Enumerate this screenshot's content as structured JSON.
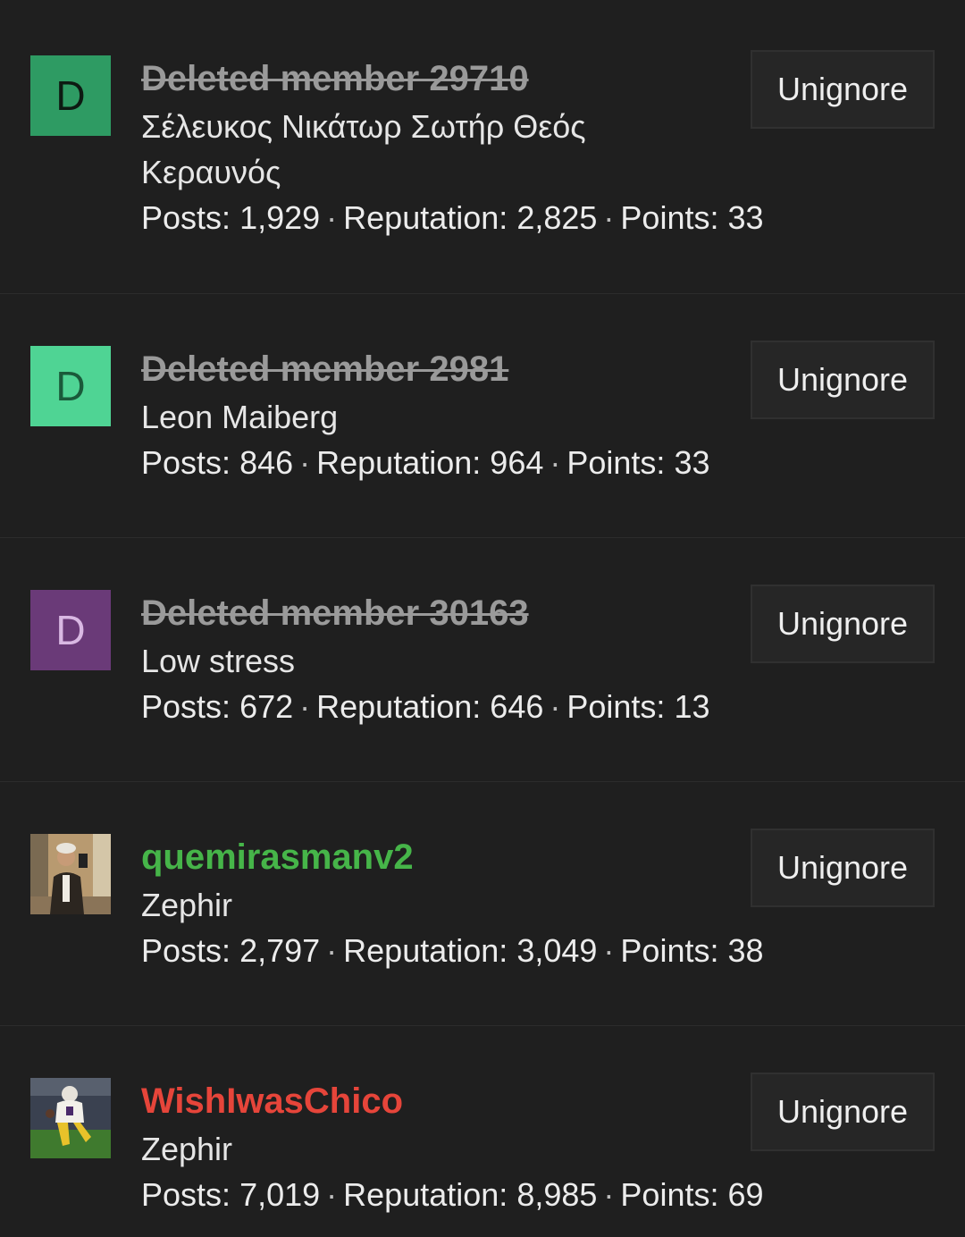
{
  "members": [
    {
      "avatar_letter": "D",
      "avatar_bg": "#2e9b63",
      "avatar_fg": "#0d1a12",
      "username": "Deleted member 29710",
      "deleted": true,
      "title": "Σέλευκος Νικάτωρ Σωτήρ Θεός Κεραυνός",
      "posts_label": "Posts:",
      "posts": "1,929",
      "rep_label": "Reputation:",
      "rep": "2,825",
      "points_label": "Points:",
      "points": "33",
      "button": "Unignore"
    },
    {
      "avatar_letter": "D",
      "avatar_bg": "#4fd494",
      "avatar_fg": "#1a5a3a",
      "username": "Deleted member 2981",
      "deleted": true,
      "title": "Leon Maiberg",
      "posts_label": "Posts:",
      "posts": "846",
      "rep_label": "Reputation:",
      "rep": "964",
      "points_label": "Points:",
      "points": "33",
      "button": "Unignore"
    },
    {
      "avatar_letter": "D",
      "avatar_bg": "#6a3a78",
      "avatar_fg": "#d9b8e3",
      "username": "Deleted member 30163",
      "deleted": true,
      "title": "Low stress",
      "posts_label": "Posts:",
      "posts": "672",
      "rep_label": "Reputation:",
      "rep": "646",
      "points_label": "Points:",
      "points": "13",
      "button": "Unignore"
    },
    {
      "avatar_photo": "person-selfie",
      "username": "quemirasmanv2",
      "username_color": "#46b549",
      "deleted": false,
      "title": "Zephir",
      "posts_label": "Posts:",
      "posts": "2,797",
      "rep_label": "Reputation:",
      "rep": "3,049",
      "points_label": "Points:",
      "points": "38",
      "button": "Unignore"
    },
    {
      "avatar_photo": "football-player",
      "username": "WishIwasChico",
      "username_color": "#e6453a",
      "deleted": false,
      "title": "Zephir",
      "posts_label": "Posts:",
      "posts": "7,019",
      "rep_label": "Reputation:",
      "rep": "8,985",
      "points_label": "Points:",
      "points": "69",
      "button": "Unignore"
    }
  ]
}
